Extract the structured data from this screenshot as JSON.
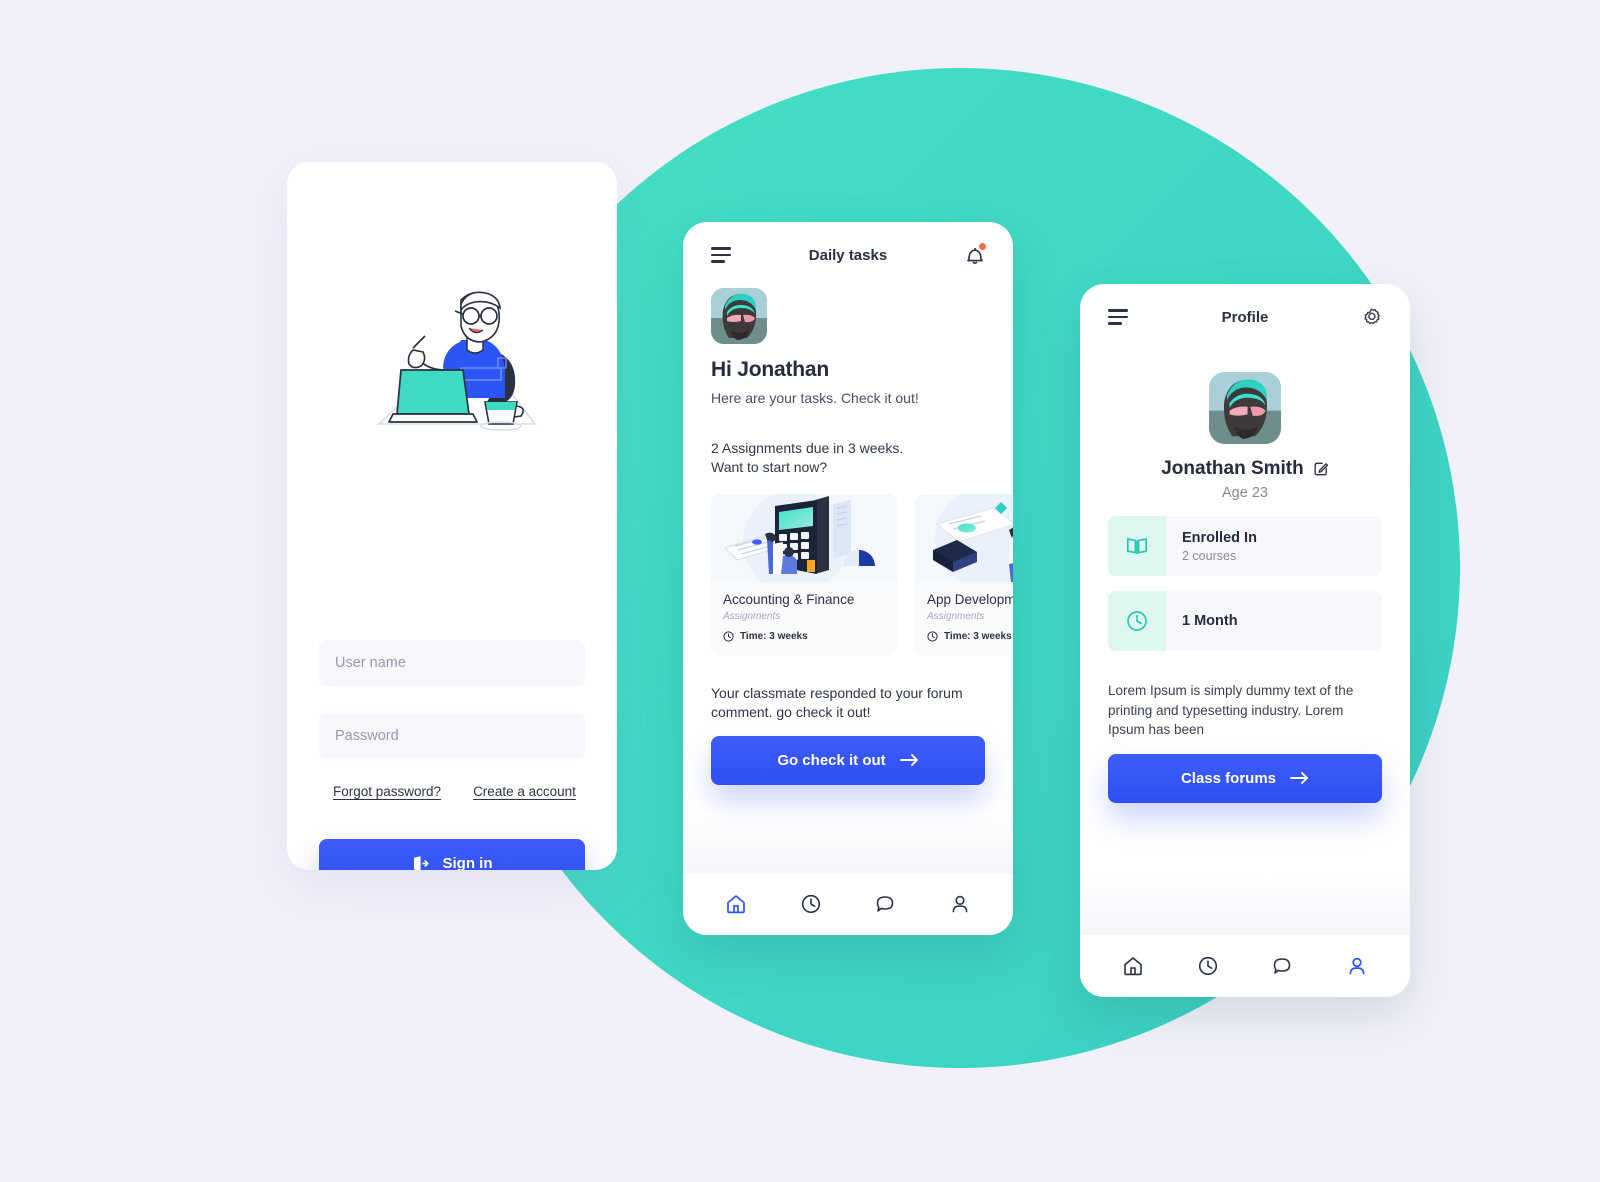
{
  "theme": {
    "background": "#F2F1FA",
    "accent_teal": "#40DDC4",
    "accent_blue": "#3E5CFA",
    "notification_dot": "#FF6B4A",
    "card_bg": "#FFFFFF"
  },
  "signin_screen": {
    "illustration_name": "person-working-at-desk-illustration",
    "username_placeholder": "User name",
    "username_value": "",
    "password_placeholder": "Password",
    "password_value": "",
    "forgot_password_label": "Forgot password?",
    "create_account_label": "Create a account",
    "signin_button_label": "Sign in",
    "signin_icon": "login-door-icon"
  },
  "tasks_screen": {
    "header": {
      "menu_icon": "hamburger-menu-icon",
      "title": "Daily tasks",
      "bell_icon": "notification-bell-icon",
      "has_notification": true
    },
    "avatar_name": "user-avatar",
    "greeting": "Hi Jonathan",
    "greeting_sub": "Here are your tasks. Check it out!",
    "assignments_note_line1": "2 Assignments due in 3 weeks.",
    "assignments_note_line2": "Want to start now?",
    "courses": [
      {
        "title": "Accounting & Finance",
        "subtitle": "Assignments",
        "time_label": "Time: 3 weeks",
        "clock_icon": "clock-icon",
        "thumb_name": "accounting-calculator-illustration"
      },
      {
        "title": "App Developm",
        "subtitle": "Assignments",
        "time_label": "Time: 3 weeks",
        "clock_icon": "clock-icon",
        "thumb_name": "app-development-illustration"
      }
    ],
    "forum_note_line1": "Your classmate responded to your forum",
    "forum_note_line2": "comment. go check it out!",
    "cta_label": "Go check it out",
    "cta_icon": "arrow-right-icon",
    "nav": [
      {
        "icon": "home-icon",
        "active": true
      },
      {
        "icon": "clock-icon",
        "active": false
      },
      {
        "icon": "chat-bubble-icon",
        "active": false
      },
      {
        "icon": "person-icon",
        "active": false
      }
    ]
  },
  "profile_screen": {
    "header": {
      "menu_icon": "hamburger-menu-icon",
      "title": "Profile",
      "settings_icon": "gear-icon"
    },
    "avatar_name": "user-avatar",
    "name": "Jonathan Smith",
    "edit_icon": "edit-pencil-icon",
    "age": "Age 23",
    "stats": [
      {
        "icon": "book-icon",
        "title": "Enrolled In",
        "subtitle": "2 courses"
      },
      {
        "icon": "clock-icon",
        "title": "1 Month",
        "subtitle": ""
      }
    ],
    "bio_line1": "Lorem Ipsum is simply dummy text of the",
    "bio_line2": "printing and typesetting industry. Lorem",
    "bio_line3": "Ipsum has been",
    "cta_label": "Class forums",
    "cta_icon": "arrow-right-icon",
    "nav": [
      {
        "icon": "home-icon",
        "active": false
      },
      {
        "icon": "clock-icon",
        "active": false
      },
      {
        "icon": "chat-bubble-icon",
        "active": false
      },
      {
        "icon": "person-icon",
        "active": true
      }
    ]
  }
}
